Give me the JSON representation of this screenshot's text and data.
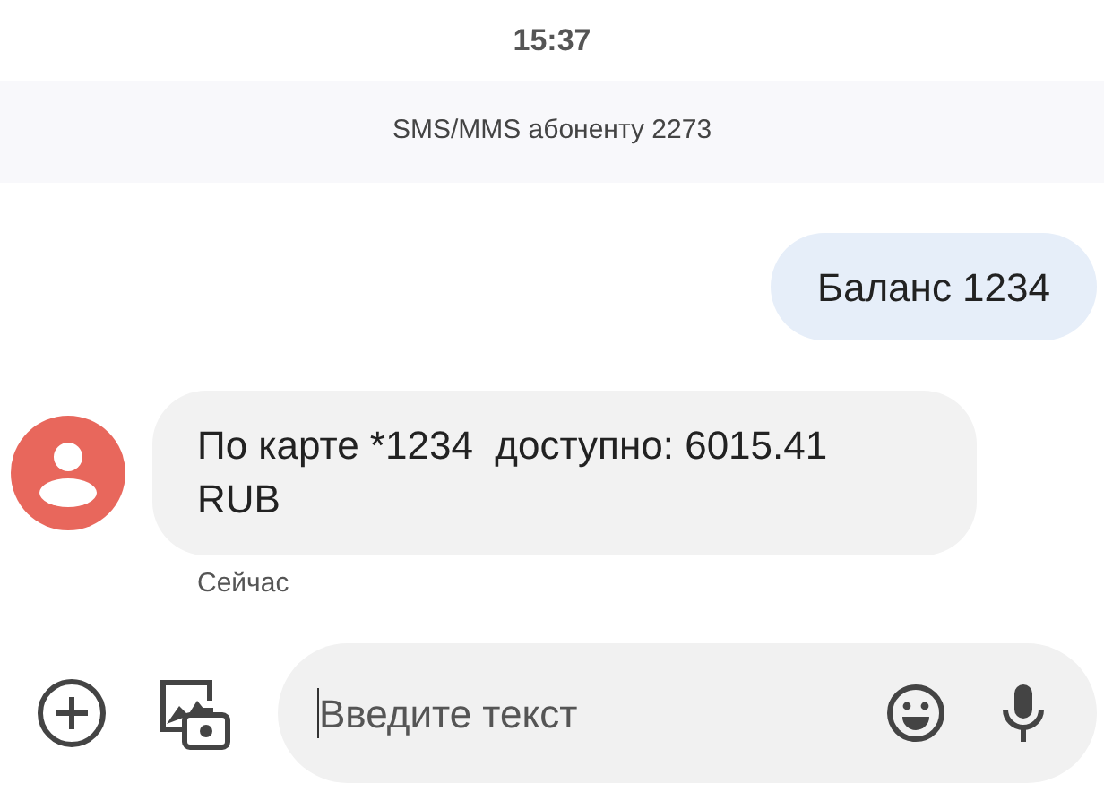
{
  "status_time": "15:37",
  "conversation_banner": "SMS/MMS абоненту 2273",
  "messages": [
    {
      "kind": "outgoing",
      "text": "Баланс 1234"
    },
    {
      "kind": "incoming",
      "text": "По карте *1234  доступно: 6015.41 RUB",
      "timestamp": "Сейчас"
    }
  ],
  "composer": {
    "placeholder": "Введите текст"
  }
}
